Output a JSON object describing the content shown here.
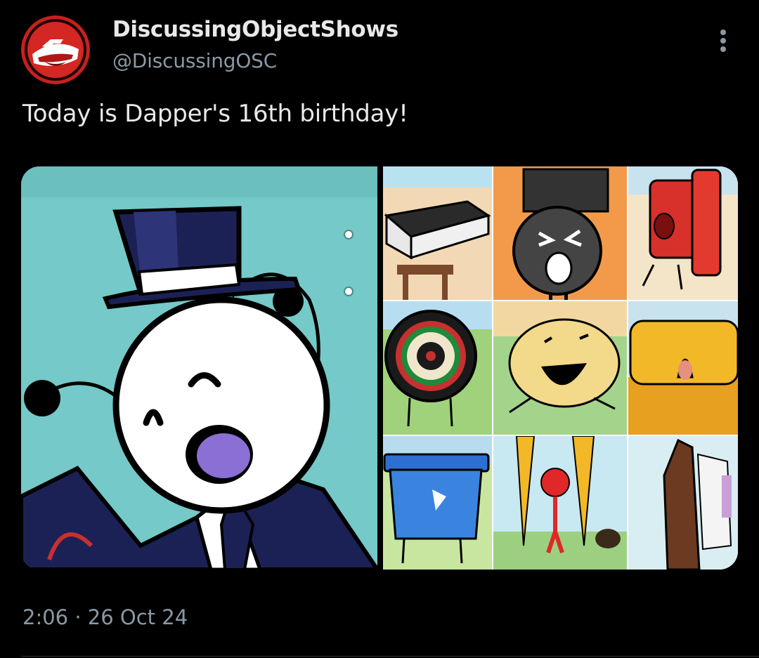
{
  "tweet": {
    "display_name": "DiscussingObjectShows",
    "handle": "@DiscussingOSC",
    "text": "Today is Dapper's 16th birthday!",
    "time": "2:06",
    "separator": "·",
    "date": "26 Oct 24"
  },
  "media": {
    "main_image": "dapper-top-hat-character-illustration",
    "grid_images": [
      "book-on-stool",
      "cpu-crying",
      "red-block-sliding",
      "dartboard-smiling",
      "sponge-cake-laughing",
      "yellow-sponge-screaming",
      "recycling-bin",
      "cherry-between-carrots",
      "chocolate-bar-crying"
    ]
  },
  "icons": {
    "avatar": "discussing-object-shows-logo",
    "more": "vertical-ellipsis-icon"
  },
  "colors": {
    "background": "#000000",
    "text_primary": "#e7e9ea",
    "text_secondary": "#8b98a5",
    "avatar_red": "#c8201f"
  }
}
